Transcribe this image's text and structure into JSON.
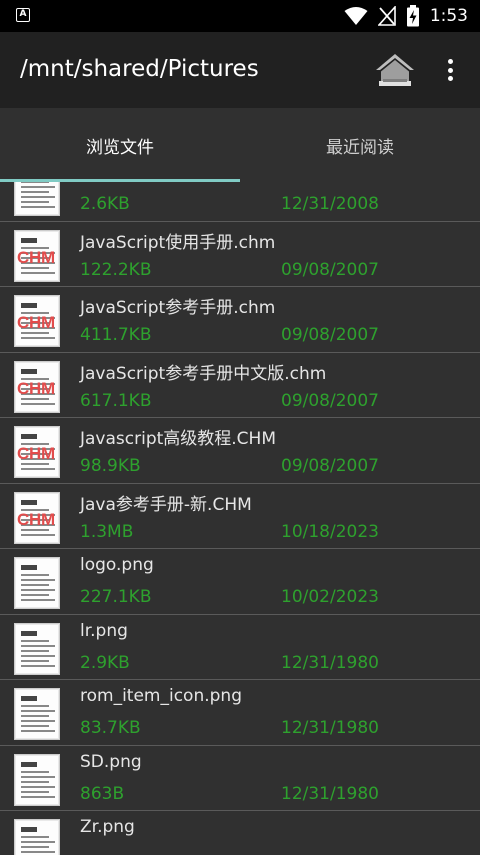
{
  "status_bar": {
    "app_badge": "A",
    "time": "1:53"
  },
  "app_bar": {
    "title": "/mnt/shared/Pictures"
  },
  "tabs": [
    {
      "label": "浏览文件"
    },
    {
      "label": "最近阅读"
    }
  ],
  "files": [
    {
      "name": "",
      "size": "2.6KB",
      "date": "12/31/2008",
      "thumb_badge": ""
    },
    {
      "name": "JavaScript使用手册.chm",
      "size": "122.2KB",
      "date": "09/08/2007",
      "thumb_badge": "CHM"
    },
    {
      "name": "JavaScript参考手册.chm",
      "size": "411.7KB",
      "date": "09/08/2007",
      "thumb_badge": "CHM"
    },
    {
      "name": "JavaScript参考手册中文版.chm",
      "size": "617.1KB",
      "date": "09/08/2007",
      "thumb_badge": "CHM"
    },
    {
      "name": "Javascript高级教程.CHM",
      "size": "98.9KB",
      "date": "09/08/2007",
      "thumb_badge": "CHM"
    },
    {
      "name": "Java参考手册-新.CHM",
      "size": "1.3MB",
      "date": "10/18/2023",
      "thumb_badge": "CHM"
    },
    {
      "name": "logo.png",
      "size": "227.1KB",
      "date": "10/02/2023",
      "thumb_badge": ""
    },
    {
      "name": "lr.png",
      "size": "2.9KB",
      "date": "12/31/1980",
      "thumb_badge": ""
    },
    {
      "name": "rom_item_icon.png",
      "size": "83.7KB",
      "date": "12/31/1980",
      "thumb_badge": ""
    },
    {
      "name": "SD.png",
      "size": "863B",
      "date": "12/31/1980",
      "thumb_badge": ""
    },
    {
      "name": "Zr.png",
      "size": "",
      "date": "",
      "thumb_badge": ""
    }
  ],
  "icons": {
    "wifi": "wifi-icon",
    "signal": "signal-off-icon",
    "battery": "battery-charging-icon",
    "home": "home-icon",
    "more": "more-vert-icon",
    "file_thumb": "document-icon"
  },
  "colors": {
    "accent_indicator": "#80cbc4",
    "meta_text": "#2ea12e",
    "badge": "#e24c4c"
  }
}
